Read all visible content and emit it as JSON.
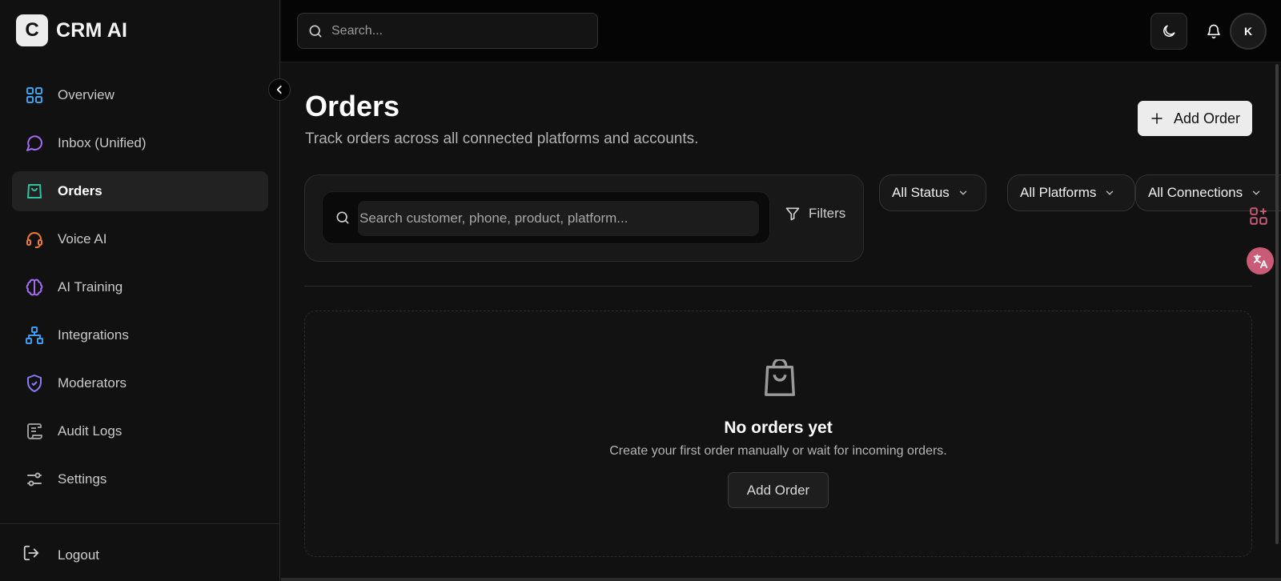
{
  "brand": {
    "logo_letter": "C",
    "name": "CRM AI"
  },
  "sidebar": {
    "items": [
      {
        "label": "Overview",
        "icon": "grid-icon",
        "color": "#3ba4f0"
      },
      {
        "label": "Inbox (Unified)",
        "icon": "message-circle-icon",
        "color": "#a56bf5"
      },
      {
        "label": "Orders",
        "icon": "shopping-bag-icon",
        "color": "#2fc4a0",
        "active": true
      },
      {
        "label": "Voice AI",
        "icon": "headset-icon",
        "color": "#f07a2c"
      },
      {
        "label": "AI Training",
        "icon": "brain-icon",
        "color": "#a56bf5"
      },
      {
        "label": "Integrations",
        "icon": "network-icon",
        "color": "#3b9cf0"
      },
      {
        "label": "Moderators",
        "icon": "shield-check-icon",
        "color": "#8a7af5"
      },
      {
        "label": "Audit Logs",
        "icon": "scroll-icon",
        "color": "#9a9a9a"
      },
      {
        "label": "Settings",
        "icon": "sliders-icon",
        "color": "#b0b0b0"
      }
    ],
    "logout_label": "Logout"
  },
  "header": {
    "search_placeholder": "Search...",
    "avatar_initial": "K"
  },
  "main": {
    "title": "Orders",
    "subtitle": "Track orders across all connected platforms and accounts.",
    "add_order_label": "Add Order",
    "filter_search_placeholder": "Search customer, phone, product, platform...",
    "filters_label": "Filters",
    "status_select": "All Status",
    "platforms_select": "All Platforms",
    "connections_select": "All Connections",
    "empty": {
      "title": "No orders yet",
      "description": "Create your first order manually or wait for incoming orders.",
      "button_label": "Add Order"
    }
  },
  "colors": {
    "background": "#111111",
    "topbar": "#050505",
    "accent_orders": "#2fc4a0",
    "translate_badge": "#c95a78"
  }
}
